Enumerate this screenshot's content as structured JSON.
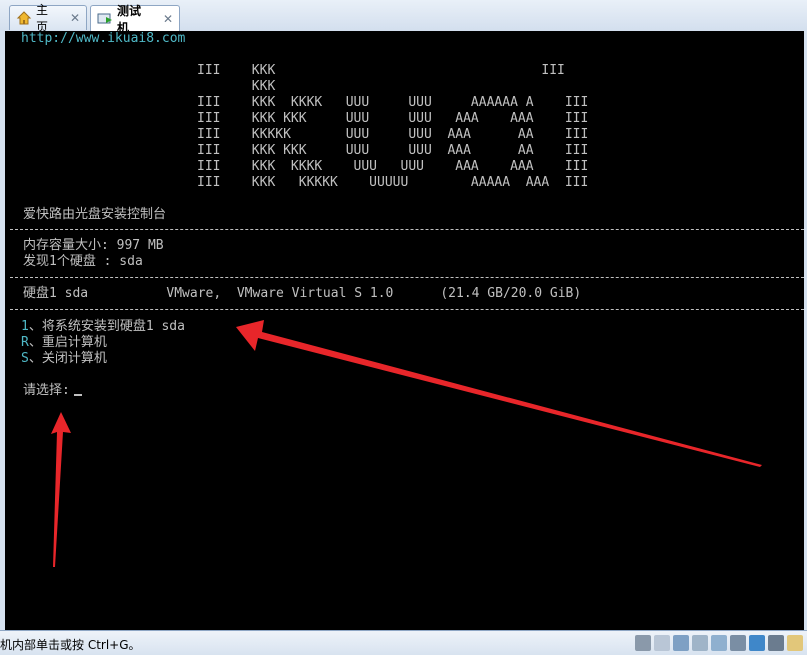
{
  "tabs": [
    {
      "label": "主页",
      "icon": "home-icon",
      "active": false
    },
    {
      "label": "测试机",
      "icon": "vm-icon",
      "active": true
    }
  ],
  "console": {
    "url": "http://www.ikuai8.com",
    "logo_lines": [
      "III    KKK                                  III",
      "       KKK",
      "III    KKK  KKKK   UUU     UUU     AAAAAA A    III",
      "III    KKK KKK     UUU     UUU   AAA    AAA    III",
      "III    KKKKK       UUU     UUU  AAA      AA    III",
      "III    KKK KKK     UUU     UUU  AAA      AA    III",
      "III    KKK  KKKK    UUU   UUU    AAA    AAA    III",
      "III    KKK   KKKKK    UUUUU        AAAAA  AAA  III"
    ],
    "title": "爱快路由光盘安装控制台",
    "memory": "内存容量大小: 997 MB",
    "disk_found": "发现1个硬盘 : sda",
    "disk_row": "硬盘1 sda          VMware,  VMware Virtual S 1.0      (21.4 GB/20.0 GiB)",
    "menu": [
      {
        "key": "1",
        "text": "、将系统安装到硬盘1 sda"
      },
      {
        "key": "R",
        "text": "、重启计算机"
      },
      {
        "key": "S",
        "text": "、关闭计算机"
      }
    ],
    "prompt": "请选择:"
  },
  "status": {
    "text": "机内部单击或按 Ctrl+G。"
  },
  "colors": {
    "arrow": "#e8262a",
    "console_text": "#c0c0c0",
    "console_accent": "#4fb8c6"
  }
}
